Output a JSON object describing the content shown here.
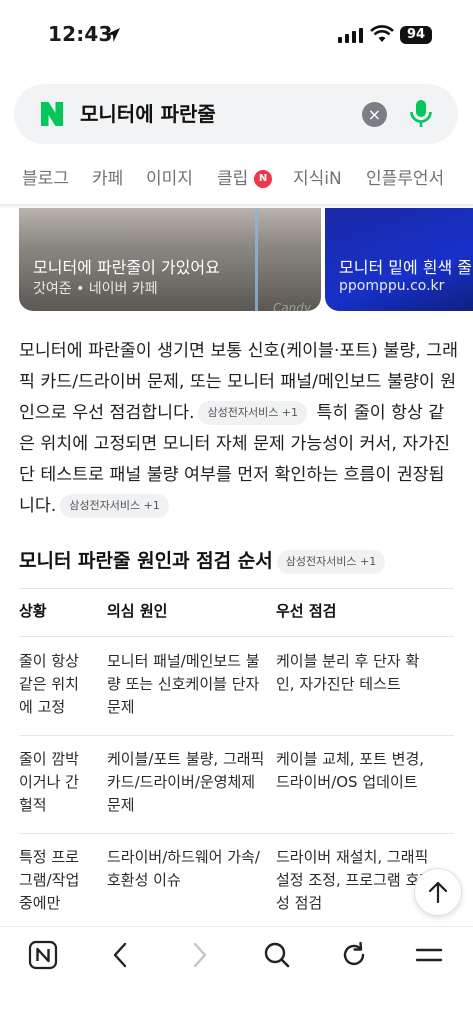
{
  "status": {
    "time": "12:43",
    "battery": "94"
  },
  "search": {
    "query": "모니터에 파란줄",
    "clear": "×"
  },
  "tabs": [
    {
      "label": "블로그"
    },
    {
      "label": "카페"
    },
    {
      "label": "이미지"
    },
    {
      "label": "클립",
      "badge": "N"
    },
    {
      "label": "지식iN"
    },
    {
      "label": "인플루언서"
    }
  ],
  "image_cards": [
    {
      "title": "모니터에 파란줄이 가있어요",
      "source": "갓여준 • 네이버 카페",
      "watermark": "Candy"
    },
    {
      "title": "모니터 밑에 흰색 줄",
      "source": "ppomppu.co.kr"
    }
  ],
  "answer": {
    "p1": "모니터에 파란줄이 생기면 보통 신호(케이블·포트) 불량, 그래픽 카드/드라이버 문제, 또는 모니터 패널/메인보드 불량이 원인으로 우선 점검합니다.",
    "chip1": "삼성전자서비스 +1",
    "p2": "특히 줄이 항상 같은 위치에 고정되면 모니터 자체 문제 가능성이 커서, 자가진단 테스트로 패널 불량 여부를 먼저 확인하는 흐름이 권장됩니다.",
    "chip2": "삼성전자서비스 +1"
  },
  "section": {
    "title": "모니터 파란줄 원인과 점검 순서",
    "chip": "삼성전자서비스 +1"
  },
  "table": {
    "headers": [
      "상황",
      "의심 원인",
      "우선 점검"
    ],
    "rows": [
      [
        "줄이 항상 같은 위치에 고정",
        "모니터 패널/메인보드 불량 또는 신호케이블 단자 문제",
        "케이블 분리 후 단자 확인, 자가진단 테스트"
      ],
      [
        "줄이 깜박이거나 간헐적",
        "케이블/포트 불량, 그래픽 카드/드라이버/운영체제 문제",
        "케이블 교체, 포트 변경, 드라이버/OS 업데이트"
      ],
      [
        "특정 프로그램/작업 중에만",
        "드라이버/하드웨어 가속/호환성 이슈",
        "드라이버 재설치, 그래픽 설정 조정, 프로그램 호환성 점검"
      ]
    ]
  },
  "colors": {
    "naver_green": "#03c75a",
    "badge_red": "#f0374a"
  }
}
